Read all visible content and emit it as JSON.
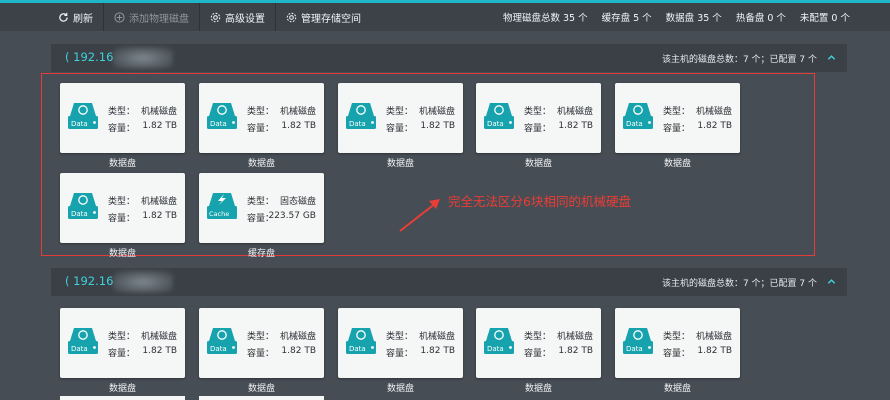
{
  "toolbar": {
    "refresh": "刷新",
    "add_disk": "添加物理磁盘",
    "advanced": "高级设置",
    "manage_space": "管理存储空间"
  },
  "stats": {
    "physical": "物理磁盘总数 35 个",
    "cache": "缓存盘 5 个",
    "data": "数据盘 35 个",
    "hot_spare": "热备盘 0 个",
    "unconfigured": "未配置 0 个"
  },
  "hosts": [
    {
      "ip": "( 192.16",
      "summary": "该主机的磁盘总数：7 个；已配置 7 个",
      "disks": [
        {
          "label_type": "类型：",
          "type": "机械磁盘",
          "label_cap": "容量：",
          "capacity": "1.82 TB",
          "badge": "Data",
          "caption": "数据盘"
        },
        {
          "label_type": "类型：",
          "type": "机械磁盘",
          "label_cap": "容量：",
          "capacity": "1.82 TB",
          "badge": "Data",
          "caption": "数据盘"
        },
        {
          "label_type": "类型：",
          "type": "机械磁盘",
          "label_cap": "容量：",
          "capacity": "1.82 TB",
          "badge": "Data",
          "caption": "数据盘"
        },
        {
          "label_type": "类型：",
          "type": "机械磁盘",
          "label_cap": "容量：",
          "capacity": "1.82 TB",
          "badge": "Data",
          "caption": "数据盘"
        },
        {
          "label_type": "类型：",
          "type": "机械磁盘",
          "label_cap": "容量：",
          "capacity": "1.82 TB",
          "badge": "Data",
          "caption": "数据盘"
        },
        {
          "label_type": "类型：",
          "type": "机械磁盘",
          "label_cap": "容量：",
          "capacity": "1.82 TB",
          "badge": "Data",
          "caption": "数据盘"
        },
        {
          "label_type": "类型：",
          "type": "固态磁盘",
          "label_cap": "容量：",
          "capacity": "223.57 GB",
          "badge": "Cache",
          "caption": "缓存盘"
        }
      ]
    },
    {
      "ip": "( 192.16",
      "summary": "该主机的磁盘总数：7 个；已配置 7 个",
      "disks": [
        {
          "label_type": "类型：",
          "type": "机械磁盘",
          "label_cap": "容量：",
          "capacity": "1.82 TB",
          "badge": "Data",
          "caption": "数据盘"
        },
        {
          "label_type": "类型：",
          "type": "机械磁盘",
          "label_cap": "容量：",
          "capacity": "1.82 TB",
          "badge": "Data",
          "caption": "数据盘"
        },
        {
          "label_type": "类型：",
          "type": "机械磁盘",
          "label_cap": "容量：",
          "capacity": "1.82 TB",
          "badge": "Data",
          "caption": "数据盘"
        },
        {
          "label_type": "类型：",
          "type": "机械磁盘",
          "label_cap": "容量：",
          "capacity": "1.82 TB",
          "badge": "Data",
          "caption": "数据盘"
        },
        {
          "label_type": "类型：",
          "type": "机械磁盘",
          "label_cap": "容量：",
          "capacity": "1.82 TB",
          "badge": "Data",
          "caption": "数据盘"
        }
      ]
    }
  ],
  "annotation": "完全无法区分6块相同的机械硬盘",
  "colors": {
    "accent": "#1fb6c8",
    "disk_icon": "#16a3ad",
    "annotation": "#ea3d35"
  }
}
